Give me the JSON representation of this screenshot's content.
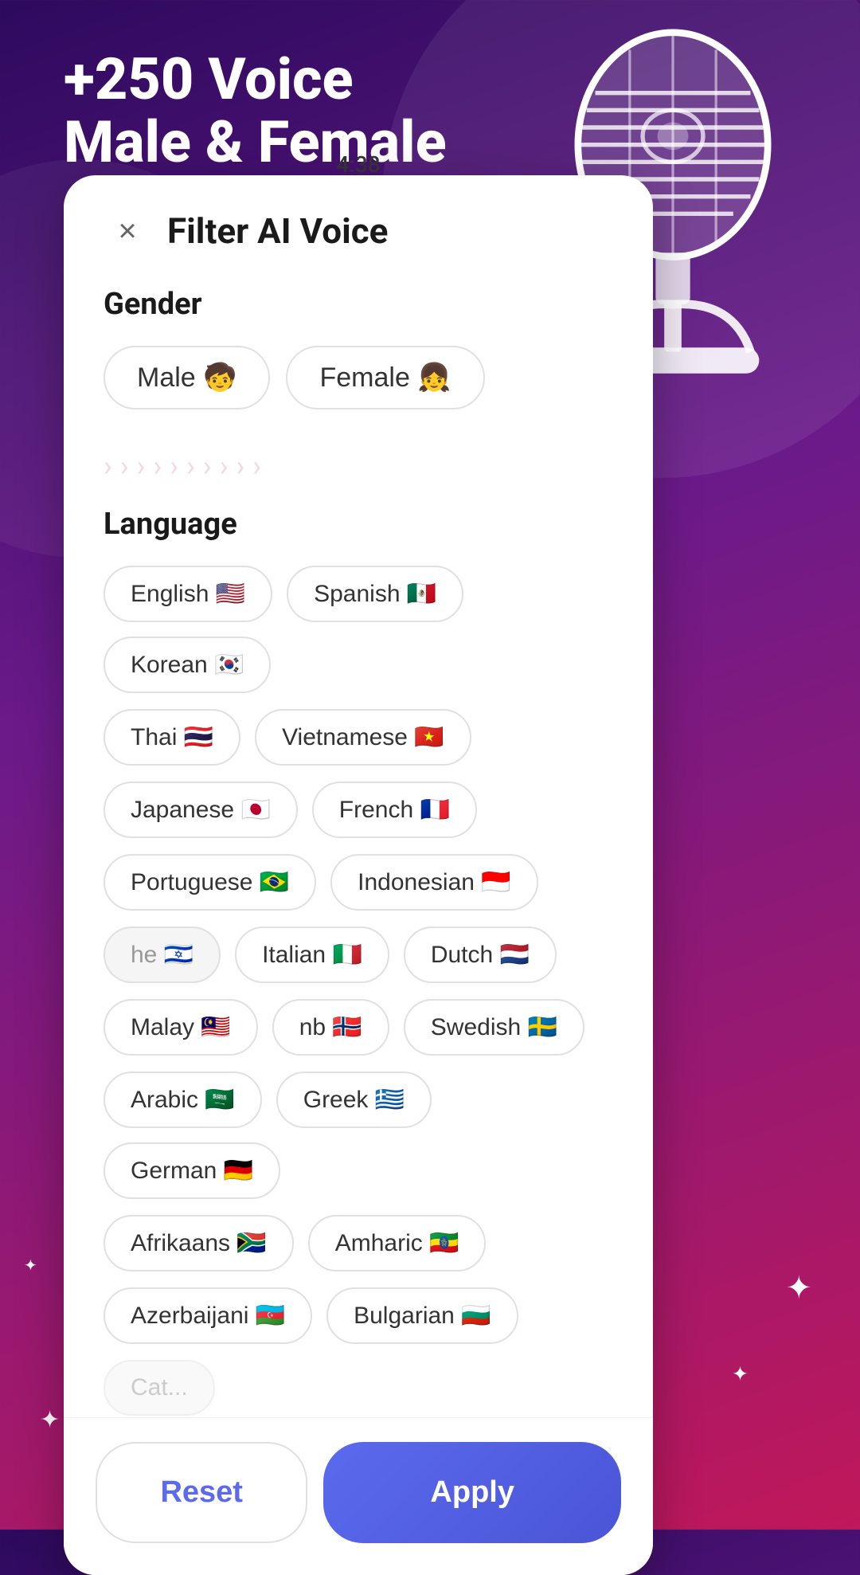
{
  "background": {
    "promo_line1": "+250 Voice",
    "promo_line2": "Male & Female"
  },
  "modal": {
    "time": "4:38",
    "title": "Filter AI Voice",
    "close_icon": "×",
    "gender_section_label": "Gender",
    "gender_buttons": [
      {
        "label": "Male 🧒",
        "id": "male"
      },
      {
        "label": "Female 👧",
        "id": "female"
      }
    ],
    "language_section_label": "Language",
    "languages": [
      {
        "label": "English 🇺🇸",
        "id": "english"
      },
      {
        "label": "Spanish 🇲🇽",
        "id": "spanish"
      },
      {
        "label": "Korean 🇰🇷",
        "id": "korean"
      },
      {
        "label": "Thai 🇹🇭",
        "id": "thai"
      },
      {
        "label": "Vietnamese 🇻🇳",
        "id": "vietnamese"
      },
      {
        "label": "Japanese 🇯🇵",
        "id": "japanese"
      },
      {
        "label": "French 🇫🇷",
        "id": "french"
      },
      {
        "label": "Portuguese 🇧🇷",
        "id": "portuguese"
      },
      {
        "label": "Indonesian 🇮🇩",
        "id": "indonesian"
      },
      {
        "label": "he 🇮🇱",
        "id": "hebrew"
      },
      {
        "label": "Italian 🇮🇹",
        "id": "italian"
      },
      {
        "label": "Dutch 🇳🇱",
        "id": "dutch"
      },
      {
        "label": "Malay 🇲🇾",
        "id": "malay"
      },
      {
        "label": "nb 🇳🇴",
        "id": "norwegian"
      },
      {
        "label": "Swedish 🇸🇪",
        "id": "swedish"
      },
      {
        "label": "Arabic 🇸🇦",
        "id": "arabic"
      },
      {
        "label": "Greek 🇬🇷",
        "id": "greek"
      },
      {
        "label": "German 🇩🇪",
        "id": "german"
      },
      {
        "label": "Afrikaans 🇿🇦",
        "id": "afrikaans"
      },
      {
        "label": "Amharic 🇪🇹",
        "id": "amharic"
      },
      {
        "label": "Azerbaijani 🇦🇿",
        "id": "azerbaijani"
      },
      {
        "label": "Bulgarian 🇧🇬",
        "id": "bulgarian"
      }
    ],
    "reset_label": "Reset",
    "apply_label": "Apply"
  }
}
